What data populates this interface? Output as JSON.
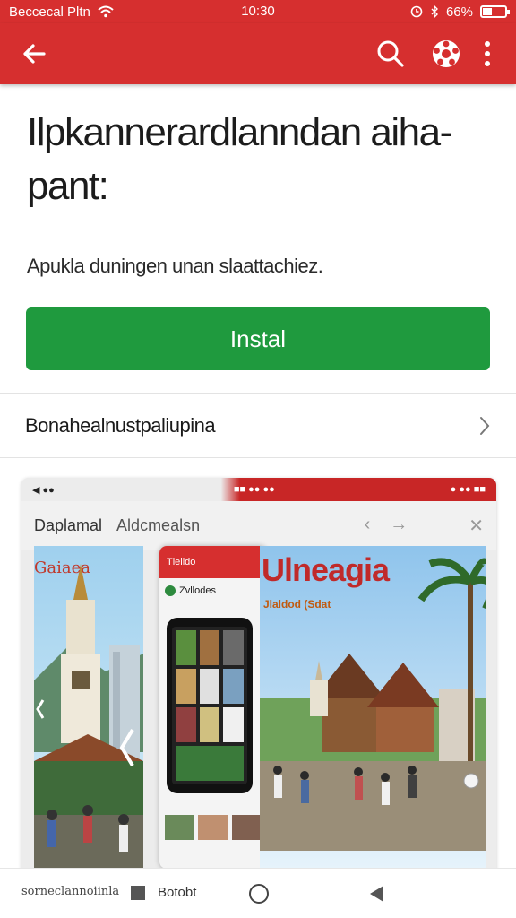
{
  "status_bar": {
    "carrier": "Beccecal Pltn",
    "time": "10:30",
    "battery": "66%"
  },
  "app_bar": {
    "back_icon": "arrow-left-icon",
    "search_icon": "search-icon",
    "settings_icon": "gear-icon",
    "menu_icon": "more-vertical-icon"
  },
  "main": {
    "title": "Ilpkannerardlanndan aiha-pant:",
    "subtitle": "Apukla duningen unan slaattachiez.",
    "install_label": "Instal",
    "row_label": "Bonahealnustpaliupina"
  },
  "preview": {
    "status_left": "◀ ●●",
    "status_mid": "■■ ●● ●●",
    "status_right": "● ●● ■■",
    "tab_primary": "Daplamal",
    "tab_secondary": "Aldcmealsn",
    "left_scene_label": "Gaiaea",
    "right_scene_title": "Ulneagia",
    "right_scene_sub": "Jlaldod (Sdat",
    "phone_header": "Tlelldo",
    "phone_row": "Zvllodes"
  },
  "system_bar": {
    "left_text": "sorneclannoiinla",
    "recents_label": "Botobt"
  },
  "colors": {
    "brand_red": "#d62f2f",
    "install_green": "#1f9a3e"
  }
}
